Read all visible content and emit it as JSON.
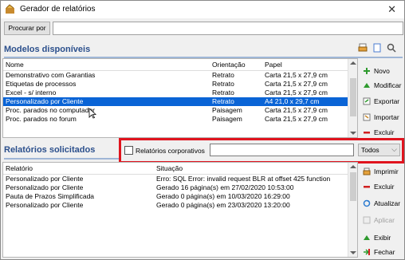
{
  "window": {
    "title": "Gerador de relatórios",
    "close": "✕"
  },
  "search": {
    "button_label": "Procurar por",
    "value": ""
  },
  "models": {
    "title": "Modelos disponíveis",
    "columns": [
      "Nome",
      "Orientação",
      "Papel"
    ],
    "rows": [
      [
        "Demonstrativo com Garantias",
        "Retrato",
        "Carta 21,5 x 27,9 cm"
      ],
      [
        "Etiquetas de processos",
        "Retrato",
        "Carta 21,5 x 27,9 cm"
      ],
      [
        "Excel - s/ interno",
        "Retrato",
        "Carta 21,5 x 27,9 cm"
      ],
      [
        "Personalizado por Cliente",
        "Retrato",
        "A4 21,0 x 29,7 cm"
      ],
      [
        "Proc. parados no computador",
        "Paisagem",
        "Carta 21,5 x 27,9 cm"
      ],
      [
        "Proc. parados no forum",
        "Paisagem",
        "Carta 21,5 x 27,9 cm"
      ]
    ],
    "buttons": [
      "Novo",
      "Modificar",
      "Exportar",
      "Importar",
      "Excluir"
    ]
  },
  "requests": {
    "title": "Relatórios solicitados",
    "corporate_label": "Relatórios corporativos",
    "filter_value": "",
    "combo_value": "Todos",
    "columns": [
      "Relatório",
      "Situação"
    ],
    "rows": [
      [
        "Personalizado por Cliente",
        "Erro: SQL Error:  invalid request BLR at offset 425 function"
      ],
      [
        "Personalizado por Cliente",
        "Gerado 16 página(s) em 27/02/2020 10:53:00"
      ],
      [
        "Pauta de Prazos Simplificada",
        "Gerado 0 página(s) em 10/03/2020 16:29:00"
      ],
      [
        "Personalizado por Cliente",
        "Gerado 0 página(s) em 23/03/2020 13:20:00"
      ]
    ],
    "buttons": [
      "Imprimir",
      "Excluir",
      "Atualizar",
      "Aplicar",
      "Exibir",
      "Fechar"
    ]
  },
  "colors": {
    "accent": "#2b4f8c",
    "selection": "#0a64d6",
    "highlight": "#e0141e"
  }
}
